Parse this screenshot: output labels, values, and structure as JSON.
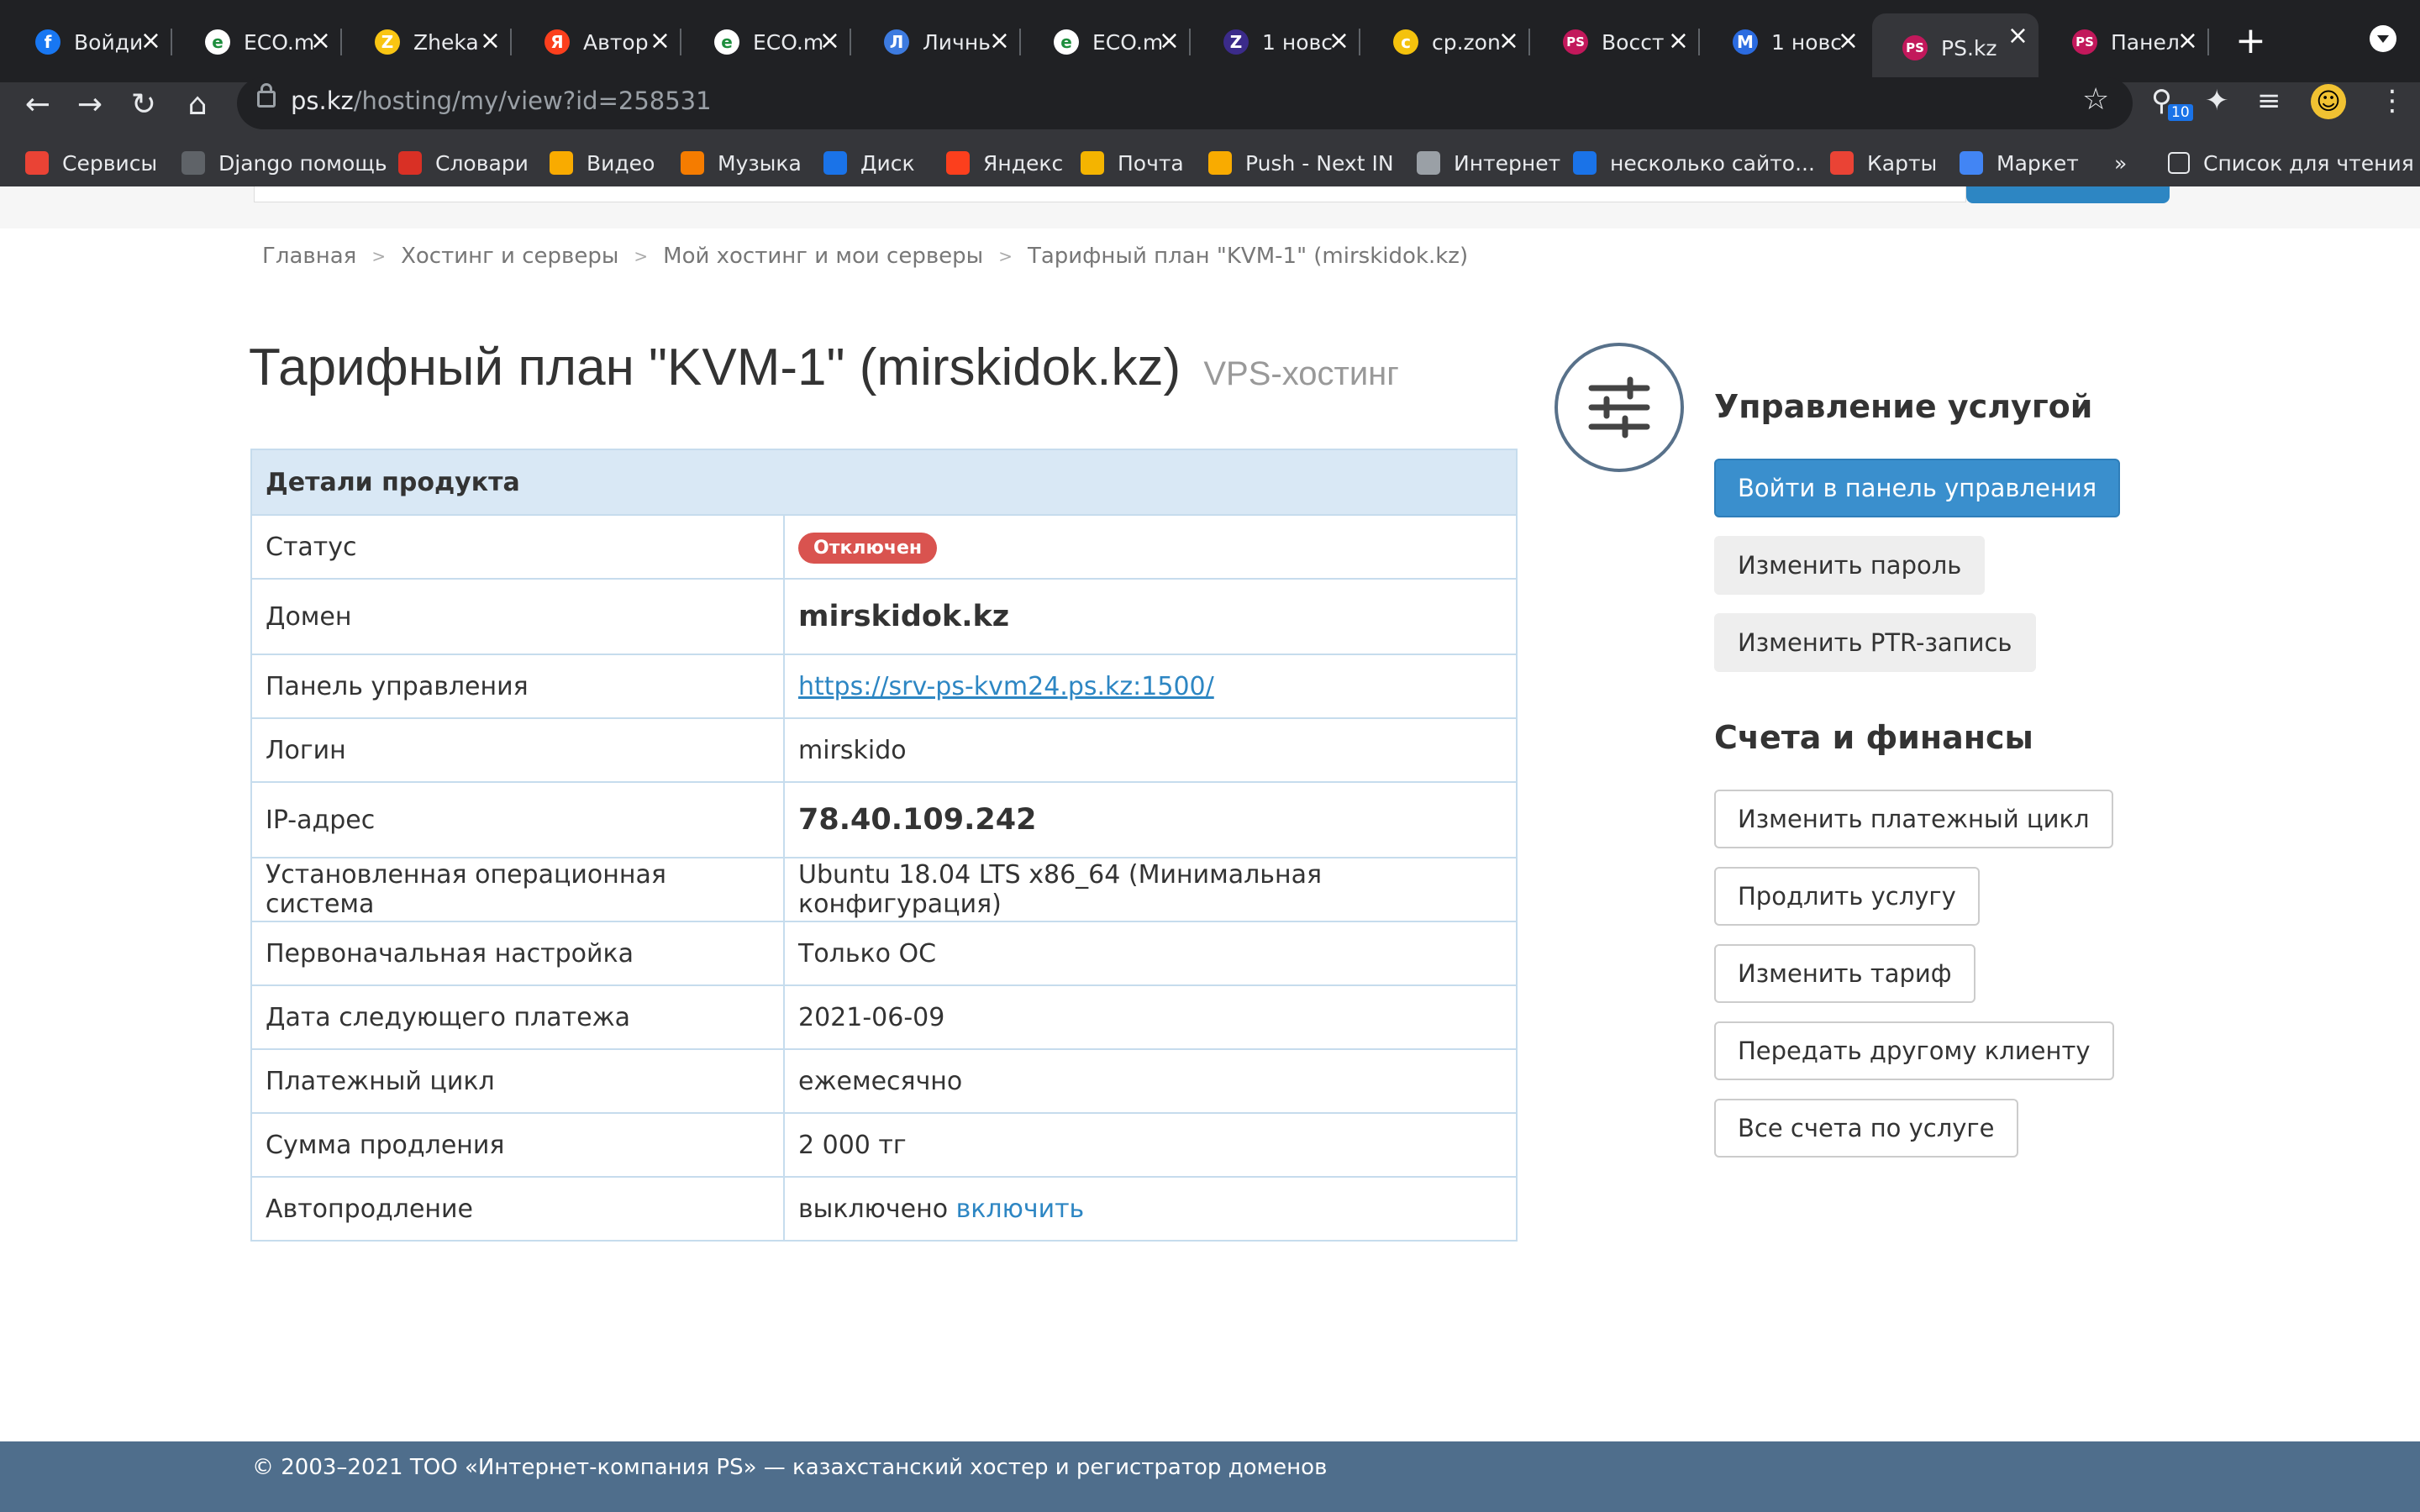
{
  "browser": {
    "tabs": [
      {
        "title": "Войди",
        "icon": "facebook-icon",
        "color": "#1877f2",
        "glyph": "f"
      },
      {
        "title": "ECO.m",
        "icon": "eco-icon",
        "color": "#ffffff",
        "glyph": "e"
      },
      {
        "title": "Zheka",
        "icon": "zheka-icon",
        "color": "#f9c513",
        "glyph": "Z"
      },
      {
        "title": "Автор",
        "icon": "yandex-icon",
        "color": "#fc3f1d",
        "glyph": "Я"
      },
      {
        "title": "ECO.m",
        "icon": "eco-icon",
        "color": "#ffffff",
        "glyph": "e"
      },
      {
        "title": "Личнь",
        "icon": "personal-icon",
        "color": "#3d7be0",
        "glyph": "Л"
      },
      {
        "title": "ECO.m",
        "icon": "eco-icon",
        "color": "#ffffff",
        "glyph": "e"
      },
      {
        "title": "1 новс",
        "icon": "zoho-icon",
        "color": "#3b2b8a",
        "glyph": "Z"
      },
      {
        "title": "cp.zon",
        "icon": "cp-icon",
        "color": "#f4c20d",
        "glyph": "c"
      },
      {
        "title": "Восст",
        "icon": "ps-icon",
        "color": "#c2185b",
        "glyph": "PS"
      },
      {
        "title": "1 новс",
        "icon": "mail-icon",
        "color": "#2b6be0",
        "glyph": "M"
      },
      {
        "title": "PS.kz",
        "icon": "ps-icon",
        "color": "#c2185b",
        "glyph": "PS"
      },
      {
        "title": "Панел",
        "icon": "ps-icon",
        "color": "#c2185b",
        "glyph": "PS"
      }
    ],
    "active_tab_index": 11,
    "url_host": "ps.kz",
    "url_path": "/hosting/my/view?id=258531",
    "extension_badge": "10",
    "bookmarks": [
      {
        "label": "Сервисы",
        "icon": "apps-icon",
        "color": "#ea4335"
      },
      {
        "label": "Django помощь",
        "icon": "django-icon",
        "color": "#5f6368"
      },
      {
        "label": "Словари",
        "icon": "dictionary-icon",
        "color": "#d93025"
      },
      {
        "label": "Видео",
        "icon": "video-icon",
        "color": "#f9ab00"
      },
      {
        "label": "Музыка",
        "icon": "music-icon",
        "color": "#f57c00"
      },
      {
        "label": "Диск",
        "icon": "disk-icon",
        "color": "#1a73e8"
      },
      {
        "label": "Яндекс",
        "icon": "yandex-icon",
        "color": "#fc3f1d"
      },
      {
        "label": "Почта",
        "icon": "mail-icon",
        "color": "#f4b400"
      },
      {
        "label": "Push - Next IN",
        "icon": "push-icon",
        "color": "#f9ab00"
      },
      {
        "label": "Интернет",
        "icon": "globe-icon",
        "color": "#9aa0a6"
      },
      {
        "label": "несколько сайто...",
        "icon": "loader-icon",
        "color": "#1a73e8"
      },
      {
        "label": "Карты",
        "icon": "map-pin-icon",
        "color": "#ea4335"
      },
      {
        "label": "Маркет",
        "icon": "market-icon",
        "color": "#4285f4"
      }
    ],
    "bookmarks_more": "»",
    "reading_list": "Список для чтения"
  },
  "page": {
    "breadcrumb": [
      "Главная",
      "Хостинг и серверы",
      "Мой хостинг и мои серверы",
      "Тарифный план \"KVM-1\" (mirskidok.kz)"
    ],
    "title": "Тарифный план \"KVM-1\" (mirskidok.kz)",
    "subtitle": "VPS-хостинг",
    "details": {
      "header": "Детали продукта",
      "status_label": "Статус",
      "status_value": "Отключен",
      "domain_label": "Домен",
      "domain_value": "mirskidok.kz",
      "panel_label": "Панель управления",
      "panel_value": "https://srv-ps-kvm24.ps.kz:1500/",
      "login_label": "Логин",
      "login_value": "mirskido",
      "ip_label": "IP-адрес",
      "ip_value": "78.40.109.242",
      "os_label": "Установленная операционная система",
      "os_value": "Ubuntu 18.04 LTS x86_64 (Минимальная конфигурация)",
      "setup_label": "Первоначальная настройка",
      "setup_value": "Только ОС",
      "next_payment_label": "Дата следующего платежа",
      "next_payment_value": "2021-06-09",
      "cycle_label": "Платежный цикл",
      "cycle_value": "ежемесячно",
      "renewal_sum_label": "Сумма продления",
      "renewal_sum_value": "2 000 тг",
      "autorenew_label": "Автопродление",
      "autorenew_value": "выключено",
      "autorenew_action": "включить"
    },
    "service": {
      "title": "Управление услугой",
      "login_panel": "Войти в панель управления",
      "change_password": "Изменить пароль",
      "change_ptr": "Изменить PTR-запись"
    },
    "finance": {
      "title": "Счета и финансы",
      "change_cycle": "Изменить платежный цикл",
      "extend": "Продлить услугу",
      "change_tariff": "Изменить тариф",
      "transfer": "Передать другому клиенту",
      "invoices": "Все счета по услуге"
    },
    "footer": "© 2003–2021 ТОО «Интернет-компания PS» — казахстанский хостер и регистратор доменов"
  },
  "colors": {
    "accent": "#3a8fcd",
    "status_badge": "#d9534f",
    "footer": "#4f6e8c",
    "table_header": "#d9e8f5"
  }
}
